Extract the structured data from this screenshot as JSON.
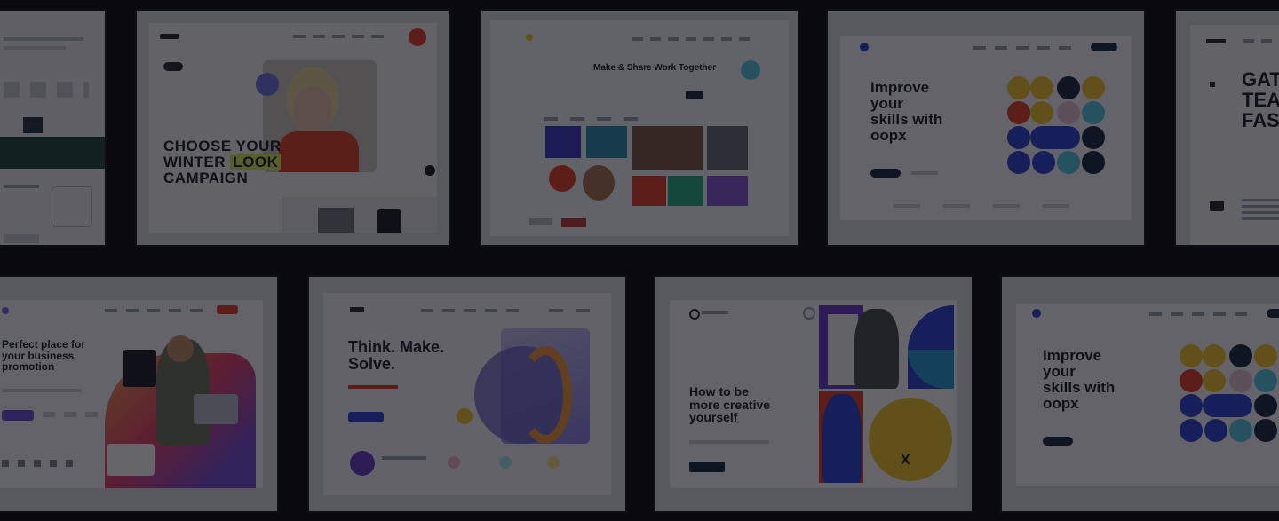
{
  "showcase": {
    "tiles": [
      {
        "id": "tile-analytics-partial"
      },
      {
        "id": "tile-winter-look",
        "headline": [
          "CHOOSE YOUR",
          "WINTER",
          "LOOK",
          "CAMPAIGN"
        ]
      },
      {
        "id": "tile-creative-grid",
        "headline": "Make & Share Work Together"
      },
      {
        "id": "tile-oopx-top",
        "headline": [
          "Improve",
          "your",
          "skills with",
          "oopx"
        ]
      },
      {
        "id": "tile-fashion-partial",
        "headline": [
          "GAT",
          "TEA",
          "FAS"
        ]
      },
      {
        "id": "tile-business-partial",
        "headline": [
          "Perfect place for",
          "your business",
          "promotion"
        ]
      },
      {
        "id": "tile-think-make",
        "headline": [
          "Think. Make.",
          "Solve."
        ]
      },
      {
        "id": "tile-creative-yourself",
        "headline": [
          "How to be",
          "more creative",
          "yourself"
        ]
      },
      {
        "id": "tile-oopx-bottom",
        "headline": [
          "Improve",
          "your",
          "skills with",
          "oopx"
        ]
      }
    ]
  },
  "colors": {
    "background": "#0b0b10",
    "overlay": "rgba(8,8,14,0.62)",
    "accent_red": "#e8412b",
    "accent_yellow": "#f4c531",
    "accent_blue": "#3046d8",
    "accent_navy": "#1f2a44"
  }
}
